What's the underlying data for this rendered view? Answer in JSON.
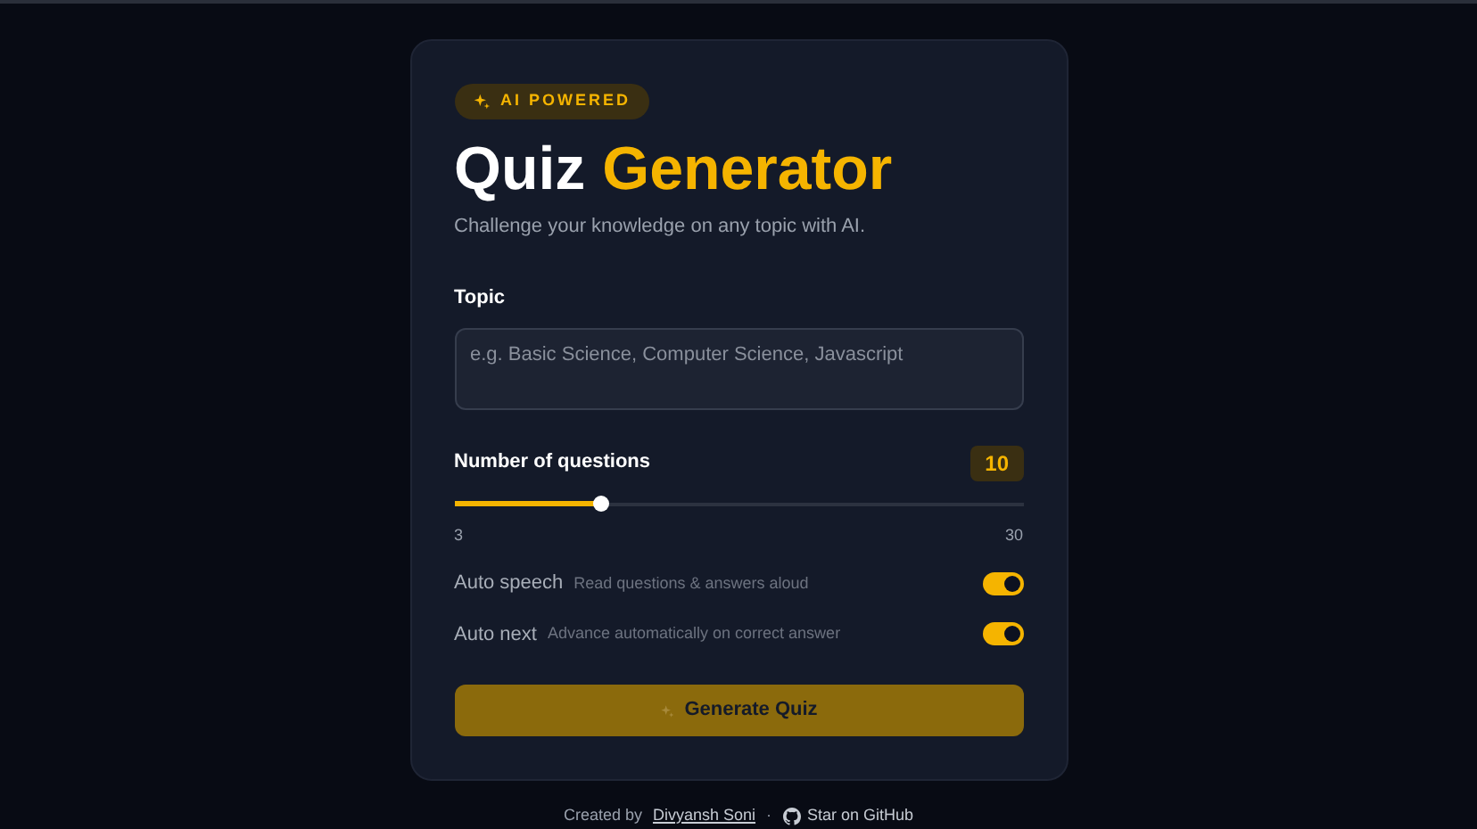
{
  "badge": "AI POWERED",
  "title": {
    "main": "Quiz",
    "accent": "Generator"
  },
  "subtitle": "Challenge your knowledge on any topic with AI.",
  "topic": {
    "label": "Topic",
    "placeholder": "e.g. Basic Science, Computer Science, Javascript"
  },
  "questions": {
    "label": "Number of questions",
    "value": "10",
    "level": 0.26,
    "min": "3",
    "max": "30"
  },
  "toggles": [
    {
      "label": "Auto speech",
      "hint": "Read questions & answers aloud",
      "on": true
    },
    {
      "label": "Auto next",
      "hint": "Advance automatically on correct answer",
      "on": true
    }
  ],
  "generate": {
    "label": "Generate Quiz",
    "disabled": true
  },
  "footer": {
    "prefix": "Created by",
    "author": "Divyansh Soni",
    "separator": "·",
    "github": "Star on GitHub"
  }
}
